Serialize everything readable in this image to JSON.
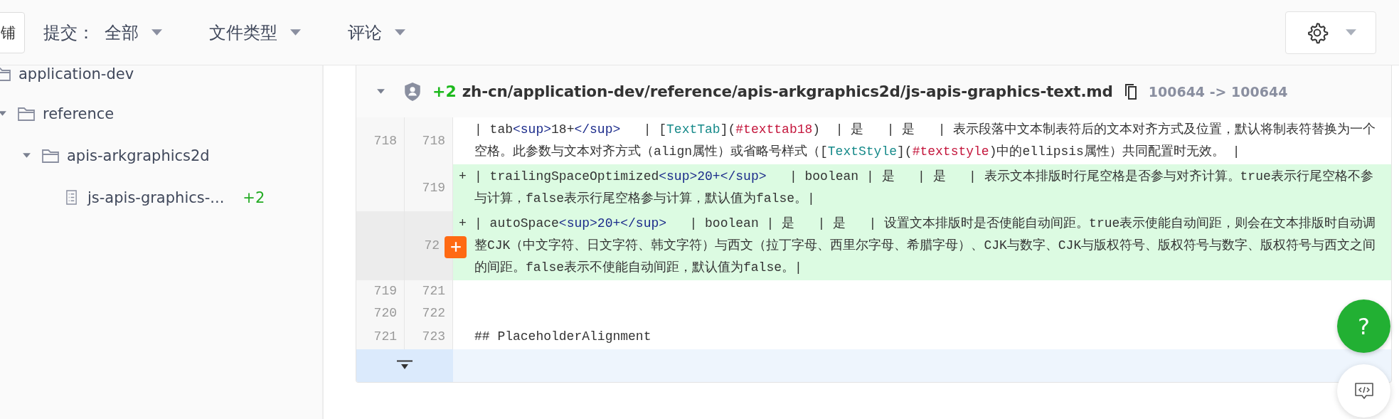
{
  "toolbar": {
    "cut_button": "铺",
    "filters": [
      {
        "label": "提交：",
        "value": "全部"
      },
      {
        "label": "文件类型"
      },
      {
        "label": "评论"
      }
    ]
  },
  "sidebar": {
    "tree": [
      {
        "label": "application-dev",
        "kind": "folder",
        "children": [
          {
            "label": "reference",
            "kind": "folder",
            "expanded": true,
            "children": [
              {
                "label": "apis-arkgraphics2d",
                "kind": "folder",
                "expanded": true,
                "children": [
                  {
                    "label": "js-apis-graphics-...",
                    "kind": "file",
                    "badge": "+2"
                  }
                ]
              }
            ]
          }
        ]
      }
    ]
  },
  "diff": {
    "expanded": true,
    "additions": "+2",
    "path": "zh-cn/application-dev/reference/apis-arkgraphics2d/js-apis-graphics-text.md",
    "mode": "100644 -> 100644",
    "rows": [
      {
        "kind": "context",
        "old": "718",
        "new": "718",
        "segments": [
          {
            "kind": "text",
            "text": "| tab"
          },
          {
            "kind": "tag",
            "text": "<sup>"
          },
          {
            "kind": "text",
            "text": "18+"
          },
          {
            "kind": "tag",
            "text": "</sup>"
          },
          {
            "kind": "text",
            "text": "   | ["
          },
          {
            "kind": "link",
            "text": "TextTab"
          },
          {
            "kind": "text",
            "text": "]("
          },
          {
            "kind": "anchor",
            "text": "#texttab18"
          },
          {
            "kind": "text",
            "text": ")  | 是   | 是   | 表示段落中文本制表符后的文本对齐方式及位置，默认将制表符替换为一个空格。此参数与文本对齐方式（align属性）或省略号样式（["
          },
          {
            "kind": "link",
            "text": "TextStyle"
          },
          {
            "kind": "text",
            "text": "]("
          },
          {
            "kind": "anchor",
            "text": "#textstyle"
          },
          {
            "kind": "text",
            "text": ")中的ellipsis属性）共同配置时无效。 |"
          }
        ]
      },
      {
        "kind": "added",
        "new": "719",
        "sign": "+",
        "hovered": false,
        "segments": [
          {
            "kind": "text",
            "text": "| trailingSpaceOptimized"
          },
          {
            "kind": "tag",
            "text": "<sup>"
          },
          {
            "kind": "tag",
            "text": "20+"
          },
          {
            "kind": "tag",
            "text": "</sup>"
          },
          {
            "kind": "text",
            "text": "   | boolean | 是   | 是   | 表示文本排版时行尾空格是否参与对齐计算。true表示行尾空格不参与计算，false表示行尾空格参与计算，默认值为false。|"
          }
        ]
      },
      {
        "kind": "added",
        "new": "72",
        "sign": "+",
        "hovered": true,
        "segments": [
          {
            "kind": "text",
            "text": "| autoSpace"
          },
          {
            "kind": "tag",
            "text": "<sup>"
          },
          {
            "kind": "tag",
            "text": "20+"
          },
          {
            "kind": "tag",
            "text": "</sup>"
          },
          {
            "kind": "text",
            "text": "   | boolean | 是   | 是   | 设置文本排版时是否使能自动间距。true表示使能自动间距，则会在文本排版时自动调整CJK（中文字符、日文字符、韩文字符）与西文（拉丁字母、西里尔字母、希腊字母）、CJK与数字、CJK与版权符号、版权符号与数字、版权符号与西文之间的间距。false表示不使能自动间距，默认值为false。|"
          }
        ]
      },
      {
        "kind": "context",
        "old": "719",
        "new": "721"
      },
      {
        "kind": "context",
        "old": "720",
        "new": "722"
      },
      {
        "kind": "context",
        "old": "721",
        "new": "723",
        "segments": [
          {
            "kind": "text",
            "text": "## PlaceholderAlignment"
          }
        ]
      },
      {
        "kind": "expand"
      }
    ]
  },
  "help_button": "?"
}
